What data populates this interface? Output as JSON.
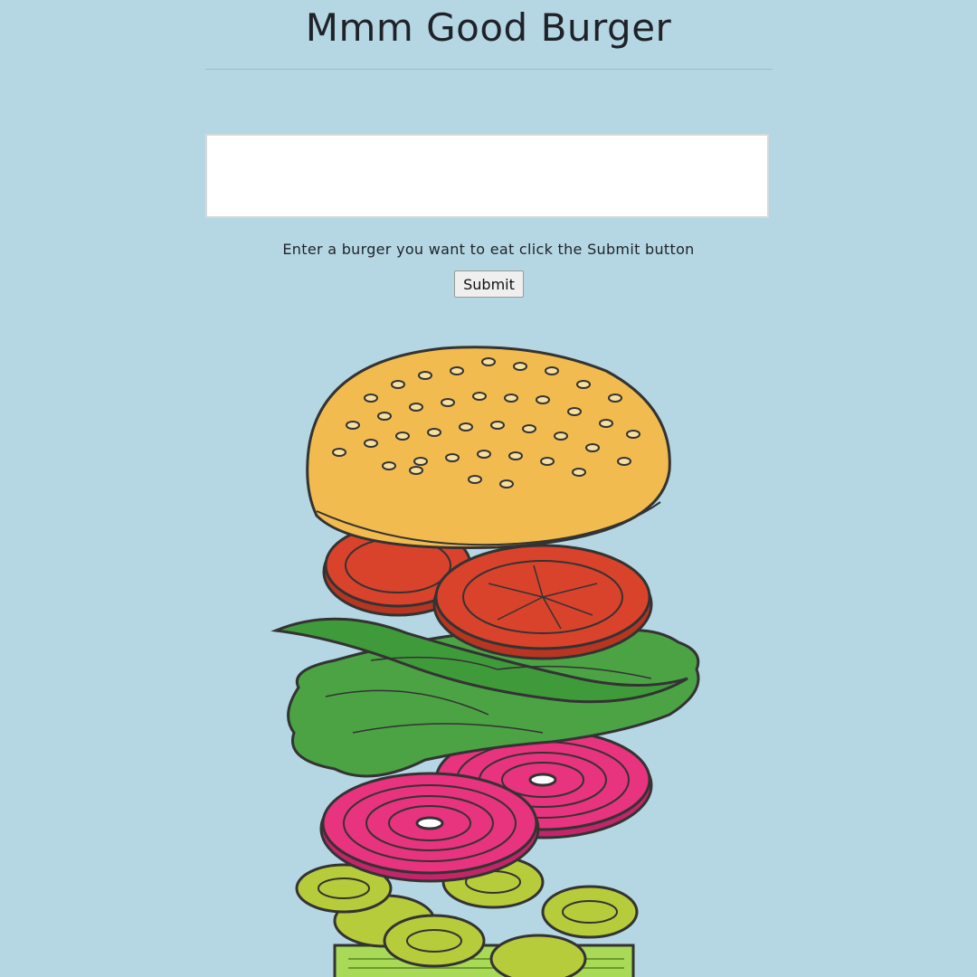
{
  "header": {
    "title": "Mmm Good Burger"
  },
  "form": {
    "input_value": "",
    "instructions": "Enter a burger you want to eat click the Submit button",
    "submit_label": "Submit"
  },
  "illustration": {
    "icon": "burger-illustration"
  },
  "colors": {
    "background": "#b4d7e3",
    "bun": "#f2bb4f",
    "tomato": "#d9432b",
    "lettuce": "#4ba344",
    "onion": "#e8337e",
    "pickle": "#b6cc3b"
  }
}
